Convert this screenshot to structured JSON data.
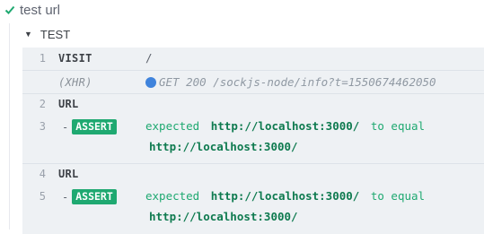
{
  "test": {
    "title": "test url",
    "status_icon": "check-icon"
  },
  "suite": {
    "name": "TEST",
    "toggle_icon": "caret-down-icon"
  },
  "commands": [
    {
      "num": "1",
      "name": "VISIT",
      "message": "/"
    },
    {
      "num": "",
      "name": "(XHR)",
      "message": "GET 200 /sockjs-node/info?t=1550674462050"
    },
    {
      "num": "2",
      "name": "URL",
      "message": ""
    },
    {
      "num": "3",
      "dash": "-",
      "badge": "ASSERT",
      "expected_word": "expected",
      "actual": "http://localhost:3000/",
      "to_equal": "to equal",
      "expected_value": "http://localhost:3000/"
    },
    {
      "num": "4",
      "name": "URL",
      "message": ""
    },
    {
      "num": "5",
      "dash": "-",
      "badge": "ASSERT",
      "expected_word": "expected",
      "actual": "http://localhost:3000/",
      "to_equal": "to equal",
      "expected_value": "http://localhost:3000/"
    }
  ],
  "colors": {
    "pass_green": "#1fa971",
    "xhr_blue": "#3f83dc",
    "row_bg": "#eef1f4"
  }
}
